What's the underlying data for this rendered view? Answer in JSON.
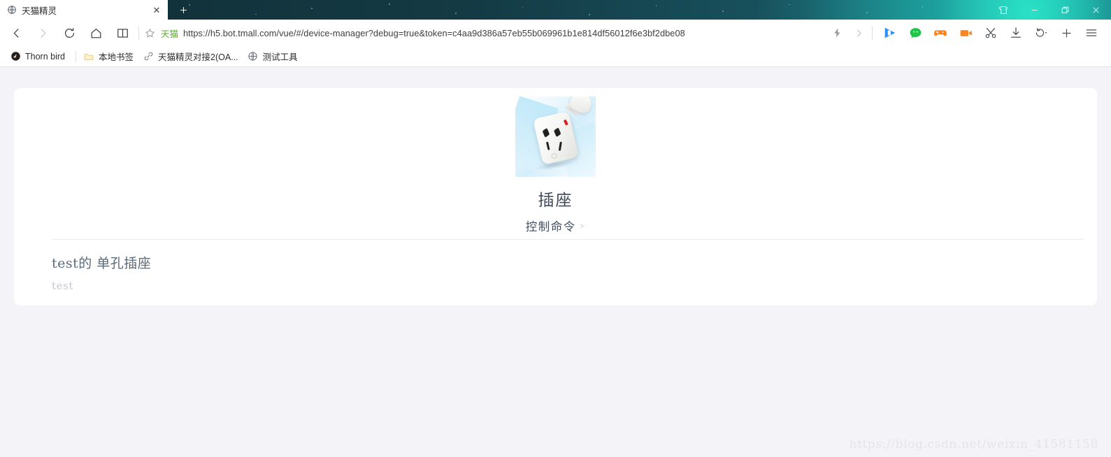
{
  "window": {
    "tab": {
      "title": "天猫精灵",
      "favicon_icon": "globe-icon",
      "close_icon": "close-icon"
    },
    "new_tab_icon": "plus-icon",
    "controls": [
      {
        "name": "skin-button",
        "icon": "tshirt-icon",
        "glyph": "skin"
      },
      {
        "name": "minimize-button",
        "icon": "minimize-icon",
        "glyph": "minimize"
      },
      {
        "name": "maximize-button",
        "icon": "maximize-icon",
        "glyph": "maximize"
      },
      {
        "name": "close-window-button",
        "icon": "close-icon",
        "glyph": "close"
      }
    ]
  },
  "navbar": {
    "back_icon": "back-arrow-icon",
    "forward_icon": "forward-arrow-icon",
    "reload_icon": "reload-icon",
    "home_icon": "home-icon",
    "reader_icon": "book-icon",
    "bookmark_star_icon": "star-icon",
    "site_chip": "天猫",
    "site_chip_color": "#5aab2e",
    "url": "https://h5.bot.tmall.com/vue/#/device-manager?debug=true&token=c4aa9d386a57eb55b069961b1e814df56012f6e3bf2dbe08",
    "url_scheme": "https://",
    "url_rest": "h5.bot.tmall.com/vue/#/device-manager?debug=true&token=c4aa9d386a57eb55b069961b1e814df56012f6e3bf2dbe08",
    "tools": [
      {
        "name": "lightning-button",
        "icon": "lightning-icon"
      },
      {
        "name": "extensions-overflow-button",
        "icon": "chevron-right-icon"
      },
      {
        "name": "video-player-button",
        "icon": "play-icon"
      },
      {
        "name": "wechat-button",
        "icon": "chat-bubble-icon"
      },
      {
        "name": "games-button",
        "icon": "gamepad-icon"
      },
      {
        "name": "screen-recorder-button",
        "icon": "camcorder-icon"
      },
      {
        "name": "screenshot-button",
        "icon": "scissors-icon"
      },
      {
        "name": "downloads-button",
        "icon": "download-icon"
      },
      {
        "name": "history-button",
        "icon": "undo-icon"
      },
      {
        "name": "add-button",
        "icon": "plus-icon"
      },
      {
        "name": "menu-button",
        "icon": "hamburger-menu-icon"
      }
    ]
  },
  "bookmarks": [
    {
      "label": "Thorn bird",
      "icon": "bird-avatar-icon"
    },
    {
      "label": "本地书签",
      "icon": "folder-icon"
    },
    {
      "label": "天猫精灵对接2(OA...",
      "icon": "link-icon"
    },
    {
      "label": "测试工具",
      "icon": "globe-icon"
    }
  ],
  "content": {
    "device": {
      "image_alt": "power-socket-photo",
      "name": "插座",
      "command_label": "控制命令",
      "command_chevron": "›"
    },
    "list": [
      {
        "title": "test的 单孔插座",
        "subtitle": "test"
      }
    ]
  },
  "watermark": "https://blog.csdn.net/weixin_41581158",
  "colors": {
    "page_background": "#f4f4f8",
    "card_background": "#ffffff",
    "accent_green": "#5aab2e",
    "title_text": "#3e4a5a",
    "muted_text": "#c9c6d2"
  }
}
